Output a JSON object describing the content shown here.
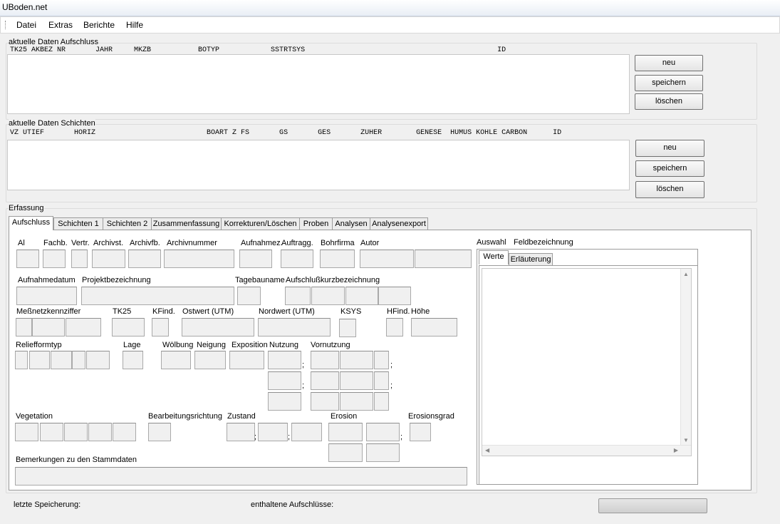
{
  "window": {
    "title": "UBoden.net"
  },
  "menu": {
    "items": [
      "Datei",
      "Extras",
      "Berichte",
      "Hilfe"
    ]
  },
  "aufschluss": {
    "group_label": "aktuelle Daten Aufschluss",
    "header": "TK25 AKBEZ NR       JAHR     MKZB           BOTYP            SSTRTSYS                                             ID",
    "buttons": {
      "neu": "neu",
      "speichern": "speichern",
      "loeschen": "löschen"
    }
  },
  "schichten": {
    "group_label": "aktuelle Daten Schichten",
    "header": "VZ UTIEF       HORIZ                          BOART Z FS       GS       GES       ZUHER        GENESE  HUMUS KOHLE CARBON      ID",
    "buttons": {
      "neu": "neu",
      "speichern": "speichern",
      "loeschen": "löschen"
    }
  },
  "erfassung": {
    "group_label": "Erfassung",
    "tabs": [
      "Aufschluss",
      "Schichten 1",
      "Schichten 2",
      "Zusammenfassung",
      "Korrekturen/Löschen",
      "Proben",
      "Analysen",
      "Analysenexport"
    ],
    "labels": {
      "al": "Al",
      "fachb": "Fachb.",
      "vertr": "Vertr.",
      "archivst": "Archivst.",
      "archivfb": "Archivfb.",
      "archivnummer": "Archivnummer",
      "aufnahmez": "Aufnahmez.",
      "auftragg": "Auftragg.",
      "bohrfirma": "Bohrfirma",
      "autor": "Autor",
      "aufnahmedatum": "Aufnahmedatum",
      "projektbezeichnung": "Projektbezeichnung",
      "tagebauname": "Tagebauname",
      "aufschlusskurz": "Aufschlußkurzbezeichnung",
      "messnetz": "Meßnetzkennziffer",
      "tk25": "TK25",
      "kfind": "KFind.",
      "ostwert": "Ostwert (UTM)",
      "nordwert": "Nordwert (UTM)",
      "ksys": "KSYS",
      "hfind": "HFind.",
      "hoehe": "Höhe",
      "relief": "Reliefformtyp",
      "lage": "Lage",
      "woelbung": "Wölbung",
      "neigung": "Neigung",
      "exposition": "Exposition",
      "nutzung": "Nutzung",
      "vornutzung": "Vornutzung",
      "vegetation": "Vegetation",
      "bearbeitung": "Bearbeitungsrichtung",
      "zustand": "Zustand",
      "erosion": "Erosion",
      "erosionsgrad": "Erosionsgrad",
      "bemerkungen": "Bemerkungen zu den Stammdaten",
      "sep": ";"
    },
    "side": {
      "auswahl": "Auswahl",
      "feldbezeichnung": "Feldbezeichnung",
      "tabs": [
        "Werte",
        "Erläuterung"
      ]
    }
  },
  "status": {
    "letzte_speicherung": "letzte Speicherung:",
    "enthaltene": "enthaltene Aufschlüsse:"
  }
}
